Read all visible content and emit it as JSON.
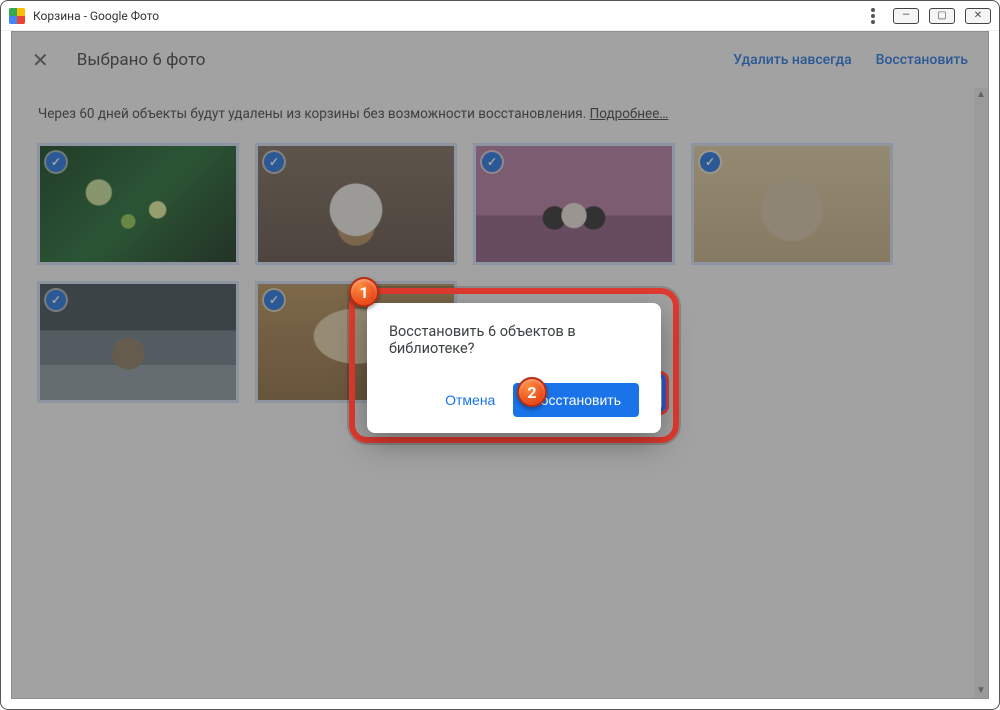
{
  "window": {
    "title": "Корзина - Google Фото"
  },
  "selection_bar": {
    "close_icon": "✕",
    "selected_text": "Выбрано 6 фото",
    "delete_forever": "Удалить навсегда",
    "restore": "Восстановить"
  },
  "notice": {
    "text": "Через 60 дней объекты будут удалены из корзины без возможности восстановления. ",
    "more": "Подробнее…"
  },
  "thumbnails": [
    {
      "id": "t1",
      "checked": true
    },
    {
      "id": "t2",
      "checked": true
    },
    {
      "id": "t3",
      "checked": true
    },
    {
      "id": "t4",
      "checked": true
    },
    {
      "id": "t5",
      "checked": true
    },
    {
      "id": "t6",
      "checked": true
    }
  ],
  "dialog": {
    "message": "Восстановить 6 объектов в библиотеке?",
    "cancel": "Отмена",
    "restore": "Восстановить"
  },
  "badges": {
    "one": "1",
    "two": "2"
  }
}
